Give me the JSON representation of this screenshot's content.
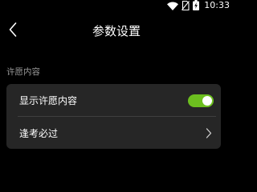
{
  "status_bar": {
    "time": "10:33",
    "icons": [
      "wifi-icon",
      "no-sim-icon",
      "battery-charging-icon"
    ]
  },
  "header": {
    "title": "参数设置",
    "back_icon": "chevron-left-icon"
  },
  "section": {
    "label": "许愿内容"
  },
  "settings": {
    "show_wish": {
      "label": "显示许愿内容",
      "enabled": true,
      "accent_color": "#6cbf1f"
    },
    "exam_pass": {
      "label": "逢考必过",
      "icon": "chevron-right-icon"
    }
  }
}
